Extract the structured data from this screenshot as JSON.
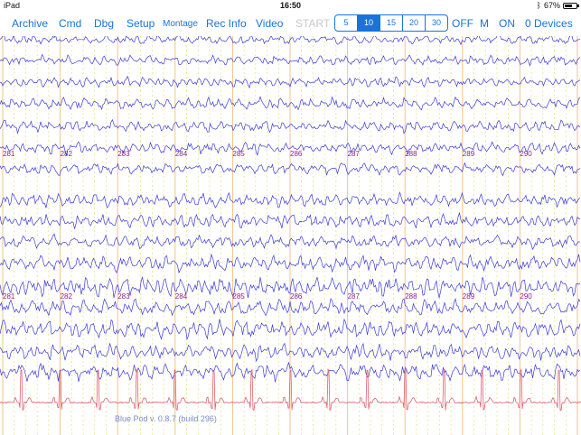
{
  "status_bar": {
    "device": "iPad",
    "time": "16:50",
    "battery_text": "67%",
    "battery_level": 0.67,
    "bluetooth_icon": "bluetooth-icon"
  },
  "toolbar": {
    "archive": "Archive",
    "cmd": "Cmd",
    "dbg": "Dbg",
    "setup": "Setup",
    "montage": "Montage",
    "rec_info": "Rec Info",
    "video": "Video",
    "start": "START",
    "seconds": [
      "5",
      "10",
      "15",
      "20",
      "30"
    ],
    "seconds_selected": "10",
    "off": "OFF",
    "m": "M",
    "on": "ON",
    "devices": "0 Devices"
  },
  "timeline": {
    "labels": [
      "281",
      "282",
      "283",
      "284",
      "285",
      "286",
      "287",
      "288",
      "289",
      "290"
    ],
    "label_color": "#8a1f8a"
  },
  "colors": {
    "accent": "#1a73d9",
    "eeg_trace": "#3b3bd6",
    "ecg_trace": "#e0606e",
    "grid_major": "#f2c38a",
    "grid_minor": "#e0d870"
  },
  "footer": {
    "version": "Blue Pod v. 0.8.7 (build 296)"
  }
}
